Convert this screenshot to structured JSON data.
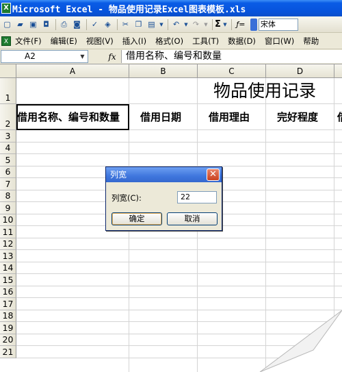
{
  "window": {
    "title": "Microsoft Excel - 物品使用记录Excel图表模板.xls",
    "app_icon": "X"
  },
  "toolbar": {
    "sum_symbol": "Σ",
    "font_name": "宋体"
  },
  "menu": {
    "items": [
      "文件(F)",
      "编辑(E)",
      "视图(V)",
      "插入(I)",
      "格式(O)",
      "工具(T)",
      "数据(D)",
      "窗口(W)",
      "帮助"
    ]
  },
  "formula_bar": {
    "cell_ref": "A2",
    "fx": "fx",
    "content": "借用名称、编号和数量"
  },
  "sheet": {
    "columns": [
      "A",
      "B",
      "C",
      "D"
    ],
    "rows": [
      "1",
      "2",
      "3",
      "4",
      "5",
      "6",
      "7",
      "8",
      "9",
      "10",
      "11",
      "12",
      "13",
      "14",
      "15",
      "16",
      "17",
      "18",
      "19",
      "20",
      "21"
    ],
    "title": "物品使用记录",
    "headers": [
      "借用名称、编号和数量",
      "借用日期",
      "借用理由",
      "完好程度",
      "借"
    ]
  },
  "dialog": {
    "title": "列宽",
    "label": "列宽(C):",
    "value": "22",
    "ok_label": "确定",
    "cancel_label": "取消"
  }
}
